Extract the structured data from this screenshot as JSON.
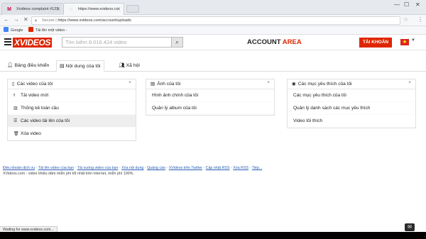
{
  "browser": {
    "tabs": [
      {
        "title": "Xvideos complaint #122",
        "favicon": "gmail-icon",
        "active": false
      },
      {
        "title": "https://www.xvideos.co",
        "favicon": "loading-icon",
        "active": true
      }
    ],
    "window_controls": [
      "—",
      "☐",
      "✕"
    ],
    "address": {
      "secure_label": "Secure",
      "url": "https://www.xvideos.com/account/uploads"
    },
    "bookmarks": [
      {
        "label": "Google",
        "icon": "google-icon"
      },
      {
        "label": "Tải lên một video -",
        "icon": "bookmark-icon"
      }
    ],
    "status_text": "Waiting for www.xvideos.com..."
  },
  "site": {
    "logo": "XVIDEOS",
    "search_placeholder": "Tìm kiếm  8.016.424  video",
    "account_title_1": "ACCOUNT",
    "account_title_2": "AREA",
    "account_button": "TÀI KHOẢN",
    "flag_symbol": "★"
  },
  "page_tabs": [
    {
      "label": "Bảng điều khiển",
      "icon": "user-icon",
      "active": false
    },
    {
      "label": "Nội dung của tôi",
      "icon": "folder-icon",
      "active": true
    },
    {
      "label": "Xã hội",
      "icon": "users-icon",
      "active": false
    }
  ],
  "panels": [
    {
      "title": "Các video của tôi",
      "icon": "file-icon",
      "items": [
        {
          "label": "Tải video mới",
          "icon": "upload-icon",
          "selected": false
        },
        {
          "label": "Thống kê toàn cầu",
          "icon": "chart-icon",
          "selected": false
        },
        {
          "label": "Các video tải lên của tôi",
          "icon": "list-icon",
          "selected": true
        },
        {
          "label": "Xóa video",
          "icon": "trash-icon",
          "selected": false
        }
      ]
    },
    {
      "title": "Ảnh của tôi",
      "icon": "image-icon",
      "items": [
        {
          "label": "Hình ảnh chính của tôi",
          "icon": "",
          "selected": false
        },
        {
          "label": "Quản lý album của tôi",
          "icon": "",
          "selected": false
        }
      ]
    },
    {
      "title": "Các mục yêu thích của tôi",
      "icon": "circle-icon",
      "items": [
        {
          "label": "Các mục yêu thích của tôi",
          "icon": "",
          "selected": false
        },
        {
          "label": "Quản lý danh sách các mục yêu thích",
          "icon": "",
          "selected": false
        },
        {
          "label": "Video tôi thích",
          "icon": "",
          "selected": false
        }
      ]
    }
  ],
  "footer": {
    "links": [
      "Điều khoản dịch vụ",
      "Tải lên video của bạn",
      "Tài xuống video của bạn",
      "Xóa nội dung",
      "Quảng cáo",
      "XVideos trên Twitter",
      "Cập nhật RSS",
      "Xóa RSS",
      "Tiếp..."
    ],
    "text": "XVideos.com - video khiêu dâm miễn phí tốt nhất trên internet, miễn phí 100%."
  },
  "colors": {
    "brand_red": "#de2600",
    "link_blue": "#2a5db0"
  }
}
